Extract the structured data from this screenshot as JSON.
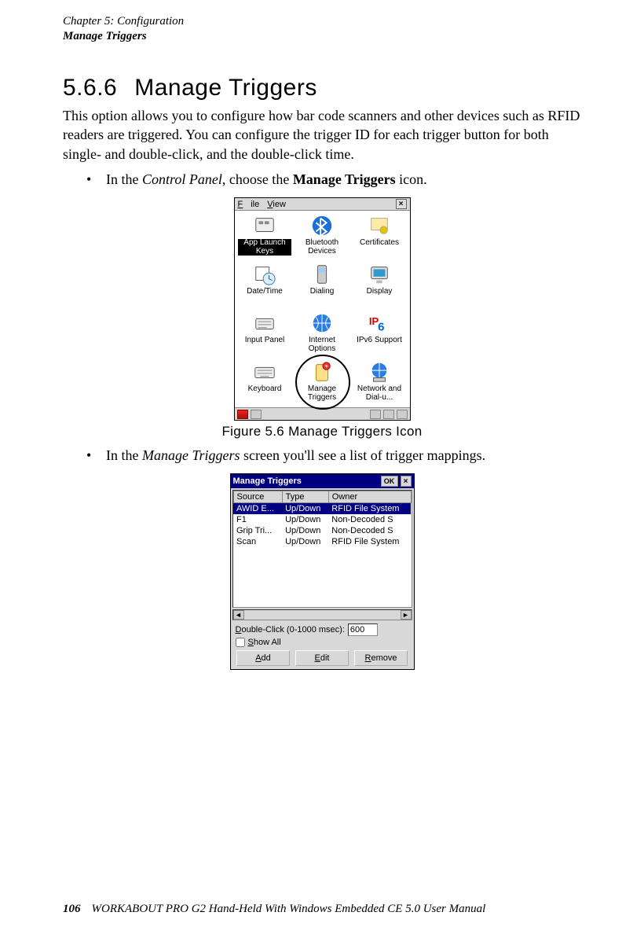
{
  "header": {
    "chapter": "Chapter 5: Configuration",
    "section_name": "Manage Triggers"
  },
  "section": {
    "number": "5.6.6",
    "title": "Manage Triggers",
    "intro": "This option allows you to configure how bar code scanners and other devices such as RFID readers are triggered. You can configure the trigger ID for each trigger button for both single- and double-click, and the double-click time.",
    "bullet1_pre": "In the ",
    "bullet1_em": "Control Panel",
    "bullet1_mid": ", choose the ",
    "bullet1_bold": "Manage Triggers",
    "bullet1_post": " icon.",
    "figure_caption": "Figure 5.6 Manage Triggers Icon",
    "bullet2_pre": "In the ",
    "bullet2_em": "Manage Triggers",
    "bullet2_post": " screen you'll see a list of trigger mappings."
  },
  "control_panel": {
    "menu_file": "File",
    "menu_view": "View",
    "items": [
      {
        "label": "App Launch Keys"
      },
      {
        "label": "Bluetooth Devices"
      },
      {
        "label": "Certificates"
      },
      {
        "label": "Date/Time"
      },
      {
        "label": "Dialing"
      },
      {
        "label": "Display"
      },
      {
        "label": "Input Panel"
      },
      {
        "label": "Internet Options"
      },
      {
        "label": "IPv6 Support"
      },
      {
        "label": "Keyboard"
      },
      {
        "label": "Manage Triggers"
      },
      {
        "label": "Network and Dial-u..."
      }
    ]
  },
  "manage_triggers": {
    "title": "Manage Triggers",
    "ok": "OK",
    "columns": {
      "source": "Source",
      "type": "Type",
      "owner": "Owner"
    },
    "rows": [
      {
        "source": "AWID E...",
        "type": "Up/Down",
        "owner": "RFID File System"
      },
      {
        "source": "F1",
        "type": "Up/Down",
        "owner": "Non-Decoded S"
      },
      {
        "source": "Grip Tri...",
        "type": "Up/Down",
        "owner": "Non-Decoded S"
      },
      {
        "source": "Scan",
        "type": "Up/Down",
        "owner": "RFID File System"
      }
    ],
    "dbl_label": "Double-Click (0-1000 msec):",
    "dbl_value": "600",
    "show_all": "Show All",
    "btn_add": "Add",
    "btn_edit": "Edit",
    "btn_remove": "Remove"
  },
  "footer": {
    "page": "106",
    "title": "WORKABOUT PRO G2 Hand-Held With Windows Embedded CE 5.0 User Manual"
  }
}
